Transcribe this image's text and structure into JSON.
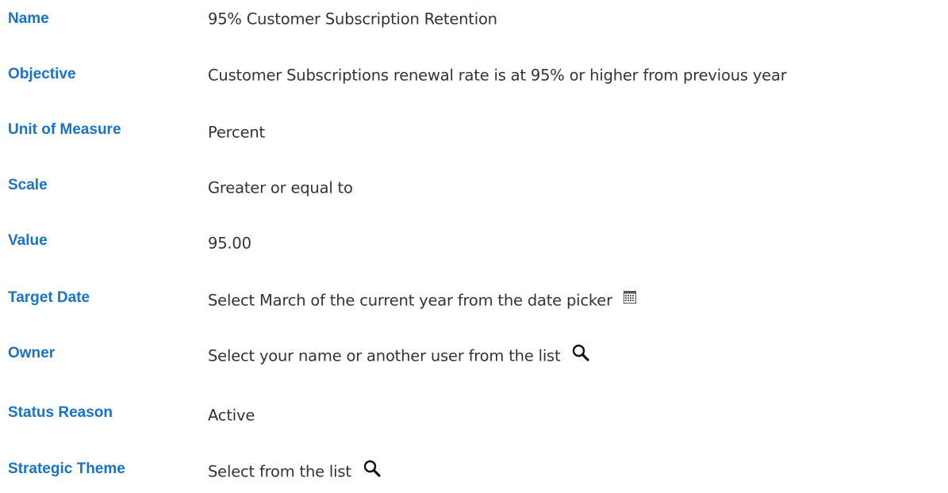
{
  "fields": [
    {
      "label": "Name",
      "value": "95% Customer Subscription Retention"
    },
    {
      "label": "Objective",
      "value": "Customer Subscriptions renewal rate is at 95% or higher from previous year"
    },
    {
      "label": "Unit of Measure",
      "value": "Percent"
    },
    {
      "label": "Scale",
      "value": "Greater or equal to"
    },
    {
      "label": "Value",
      "value": "95.00"
    },
    {
      "label": "Target Date",
      "value": "Select March of the current year from the date picker",
      "icon": "calendar-icon"
    },
    {
      "label": "Owner",
      "value": "Select your name or another user from the list",
      "icon": "search-icon"
    },
    {
      "label": "Status Reason",
      "value": "Active"
    },
    {
      "label": "Strategic Theme",
      "value": "Select from the list",
      "icon": "search-icon"
    }
  ],
  "colors": {
    "label": "#1a73c4",
    "value": "#333333",
    "background": "#ffffff"
  }
}
